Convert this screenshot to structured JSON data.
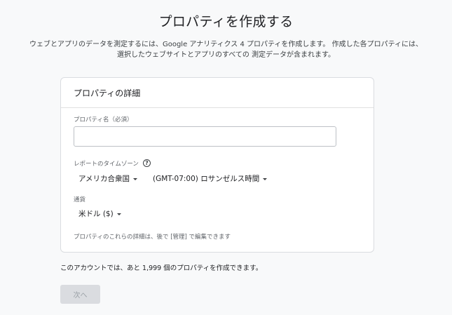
{
  "page": {
    "title": "プロパティを作成する",
    "description_line1": "ウェブとアプリのデータを測定するには、Google アナリティクス 4 プロパティを作成します。 作成した各プロパティには、",
    "description_line2": "選択したウェブサイトとアプリのすべての 測定データが含まれます。"
  },
  "card": {
    "header": "プロパティの詳細",
    "property_name": {
      "label": "プロパティ名（必須）",
      "value": ""
    },
    "timezone": {
      "label": "レポートのタイムゾーン",
      "help_icon": "question-circle-icon",
      "country": "アメリカ合衆国",
      "zone": "(GMT-07:00) ロサンゼルス時間"
    },
    "currency": {
      "label": "通貨",
      "value": "米ドル ($)"
    },
    "footnote": "プロパティのこれらの詳細は、後で [管理] で編集できます"
  },
  "account_note": "このアカウントでは、あと 1,999 個のプロパティを作成できます。",
  "next_button": "次へ"
}
